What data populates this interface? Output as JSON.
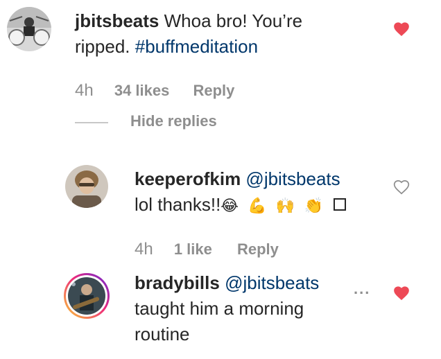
{
  "comment1": {
    "username": "jbitsbeats",
    "text_line1": "Whoa bro! You’re",
    "text_line2_prefix": "ripped. ",
    "hashtag": "#buffmeditation",
    "time": "4h",
    "likes": "34 likes",
    "reply_label": "Reply",
    "liked": true
  },
  "replies_toggle": {
    "label": "Hide replies"
  },
  "reply1": {
    "username": "keeperofkim",
    "mention": "@jbitsbeats",
    "text": "lol thanks!!",
    "emojis": [
      "😂",
      "💪",
      "🙌",
      "👏"
    ],
    "time": "4h",
    "likes": "1 like",
    "reply_label": "Reply",
    "liked": false
  },
  "reply2": {
    "username": "bradybills",
    "mention": "@jbitsbeats",
    "text_line1": "taught him a morning",
    "text_line2": "routine",
    "more_label": "...",
    "liked": true
  },
  "colors": {
    "heart_liked": "#ed4956",
    "heart_outline": "#8e8e8e",
    "link": "#00376b",
    "meta": "#8e8e8e"
  }
}
